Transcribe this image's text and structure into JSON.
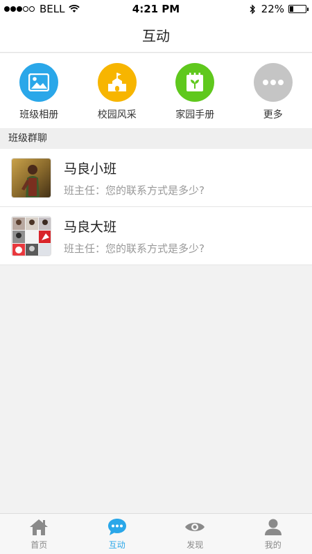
{
  "status_bar": {
    "carrier": "BELL",
    "time": "4:21 PM",
    "battery_percent": "22%",
    "battery_level": 0.22
  },
  "header": {
    "title": "互动"
  },
  "quick_actions": [
    {
      "label": "班级相册",
      "icon": "photo-album-icon",
      "color": "#2aa7e9"
    },
    {
      "label": "校园风采",
      "icon": "school-icon",
      "color": "#f7b500"
    },
    {
      "label": "家园手册",
      "icon": "handbook-icon",
      "color": "#5fc81d"
    },
    {
      "label": "更多",
      "icon": "more-icon",
      "color": "#c5c5c5"
    }
  ],
  "section": {
    "title": "班级群聊"
  },
  "chats": [
    {
      "name": "马良小班",
      "preview": "班主任：您的联系方式是多少?"
    },
    {
      "name": "马良大班",
      "preview": "班主任：您的联系方式是多少?"
    }
  ],
  "tab_bar": [
    {
      "label": "首页",
      "icon": "home-icon",
      "active": false
    },
    {
      "label": "互动",
      "icon": "chat-icon",
      "active": true
    },
    {
      "label": "发现",
      "icon": "eye-icon",
      "active": false
    },
    {
      "label": "我的",
      "icon": "user-icon",
      "active": false
    }
  ],
  "colors": {
    "accent": "#2aa7e9",
    "inactive": "#8a8a8a"
  }
}
